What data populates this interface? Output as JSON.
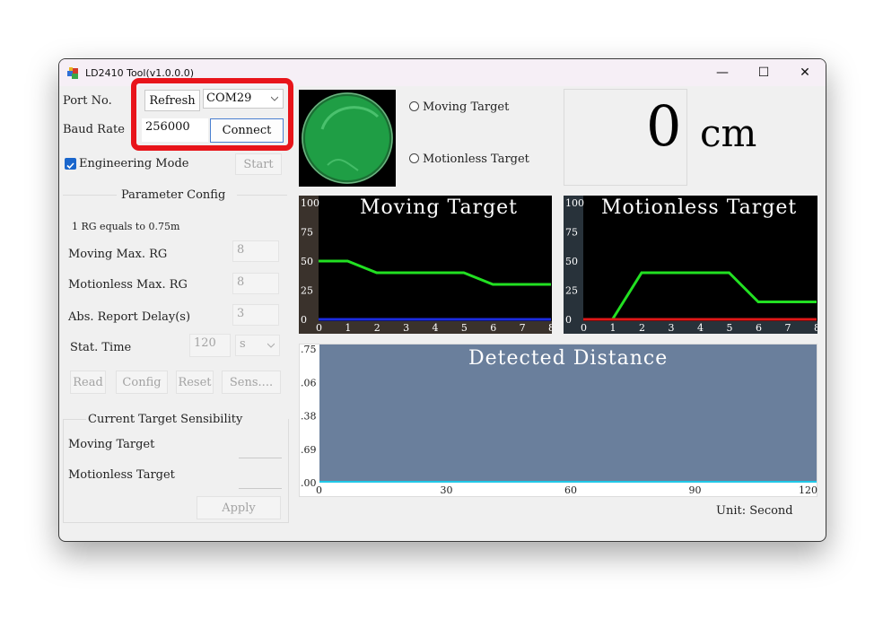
{
  "window": {
    "title": "LD2410 Tool(v1.0.0.0)",
    "minimize": "—",
    "maximize": "☐",
    "close": "✕"
  },
  "connection": {
    "port_label": "Port No.",
    "refresh_label": "Refresh",
    "port_value": "COM29",
    "baud_label": "Baud Rate",
    "baud_value": "256000",
    "connect_label": "Connect"
  },
  "engineering": {
    "label": "Engineering Mode",
    "checked": true,
    "start_label": "Start"
  },
  "parameter_config": {
    "title": "Parameter Config",
    "rg_note": "1 RG equals to 0.75m",
    "moving_max_label": "Moving Max. RG",
    "moving_max_value": "8",
    "motionless_max_label": "Motionless Max. RG",
    "motionless_max_value": "8",
    "report_delay_label": "Abs. Report Delay(s)",
    "report_delay_value": "3",
    "stat_time_label": "Stat. Time",
    "stat_time_value": "120",
    "stat_time_unit": "s",
    "read_label": "Read",
    "config_label": "Config",
    "reset_label": "Reset",
    "sens_label": "Sens...."
  },
  "sensibility": {
    "title": "Current Target Sensibility",
    "moving_label": "Moving Target",
    "motionless_label": "Motionless Target",
    "apply_label": "Apply"
  },
  "status": {
    "moving_radio": "Moving Target",
    "motionless_radio": "Motionless Target",
    "indicator_color": "#1f9e45",
    "distance_value": "0",
    "distance_unit": "cm"
  },
  "footer": {
    "unit_text": "Unit:  Second"
  },
  "icons": {
    "app": "app-icon",
    "dropdown": "chevron-down-icon",
    "checkbox": "checkbox-icon"
  },
  "chart_data": [
    {
      "type": "line",
      "title": "Moving Target",
      "x": [
        0,
        1,
        2,
        3,
        4,
        5,
        6,
        7,
        8
      ],
      "ylim": [
        0,
        100
      ],
      "y_ticks": [
        "0",
        "25",
        "50",
        "75",
        "100"
      ],
      "series": [
        {
          "color": "#22e022",
          "values": [
            50,
            50,
            40,
            40,
            40,
            40,
            30,
            30,
            30
          ]
        },
        {
          "color": "#1c2ce0",
          "values": [
            0,
            0,
            0,
            0,
            0,
            0,
            0,
            0,
            0
          ]
        }
      ]
    },
    {
      "type": "line",
      "title": "Motionless Target",
      "x": [
        0,
        1,
        2,
        3,
        4,
        5,
        6,
        7,
        8
      ],
      "ylim": [
        0,
        100
      ],
      "y_ticks": [
        "0",
        "25",
        "50",
        "75",
        "100"
      ],
      "series": [
        {
          "color": "#22e022",
          "values": [
            0,
            0,
            40,
            40,
            40,
            40,
            15,
            15,
            15
          ]
        },
        {
          "color": "#e01818",
          "values": [
            0,
            0,
            0,
            0,
            0,
            0,
            0,
            0,
            0
          ]
        }
      ]
    },
    {
      "type": "area",
      "title": "Detected Distance",
      "x_ticks": [
        "0",
        "30",
        "60",
        "90",
        "120"
      ],
      "y_ticks": [
        ".75",
        ".06",
        ".38",
        ".69",
        ".00"
      ],
      "xlim": [
        0,
        120
      ],
      "xlabel": "Unit:  Second",
      "series": [
        {
          "color": "#20c8e8",
          "values": [
            0,
            0,
            0,
            0,
            0
          ]
        }
      ]
    }
  ]
}
